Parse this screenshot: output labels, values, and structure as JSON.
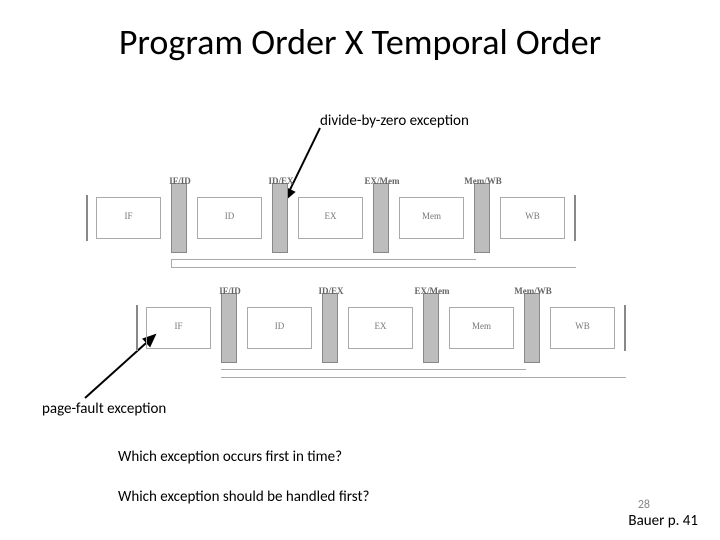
{
  "title": "Program Order X Temporal Order",
  "labels": {
    "divide_by_zero": "divide-by-zero exception",
    "page_fault": "page-fault exception"
  },
  "questions": {
    "q1": "Which exception occurs first in time?",
    "q2": "Which exception should be handled first?"
  },
  "pipeline": {
    "stages": [
      "IF",
      "ID",
      "EX",
      "Mem",
      "WB"
    ],
    "registers": [
      "IF/ID",
      "ID/EX",
      "EX/Mem",
      "Mem/WB"
    ]
  },
  "footer": {
    "page_number": "28",
    "reference": "Bauer p. 41"
  }
}
